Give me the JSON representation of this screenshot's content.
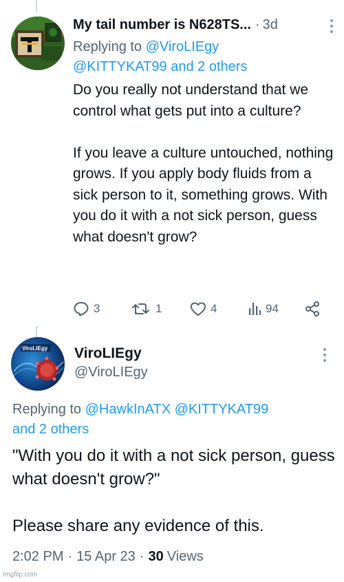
{
  "tweet1": {
    "display_name": "My tail number is N628TS...",
    "time": "3d",
    "replying_prefix": "Replying to",
    "replying_mention_1": "@ViroLIEgy",
    "replying_mention_2": "@KITTYKAT99",
    "replying_and": "and",
    "replying_others": "2 others",
    "body": "Do you really not understand that we control what gets put into a culture?\n\nIf you leave a culture untouched, nothing grows. If you apply body fluids from a sick person to it, something grows. With you do it with a not sick person, guess what doesn't grow?",
    "replies": "3",
    "retweets": "1",
    "likes": "4",
    "views": "94"
  },
  "tweet2": {
    "display_name": "ViroLIEgy",
    "handle": "@ViroLIEgy",
    "avatar_text": "ViroLIEgy",
    "replying_prefix": "Replying to",
    "replying_mention_1": "@HawkInATX",
    "replying_mention_2": "@KITTYKAT99",
    "replying_others": "and 2 others",
    "body": "\"With you do it with a not sick person, guess what doesn't grow?\"\n\nPlease share any evidence of this.",
    "time": "2:02 PM",
    "date": "15 Apr 23",
    "views_count": "30",
    "views_label": "Views"
  },
  "watermark": "imgflip.com",
  "colors": {
    "link": "#1d9bf0",
    "secondary_text": "#536471",
    "primary_text": "#0f1419"
  },
  "icons": [
    "reply-icon",
    "retweet-icon",
    "like-icon",
    "views-icon",
    "share-icon",
    "more-icon"
  ]
}
